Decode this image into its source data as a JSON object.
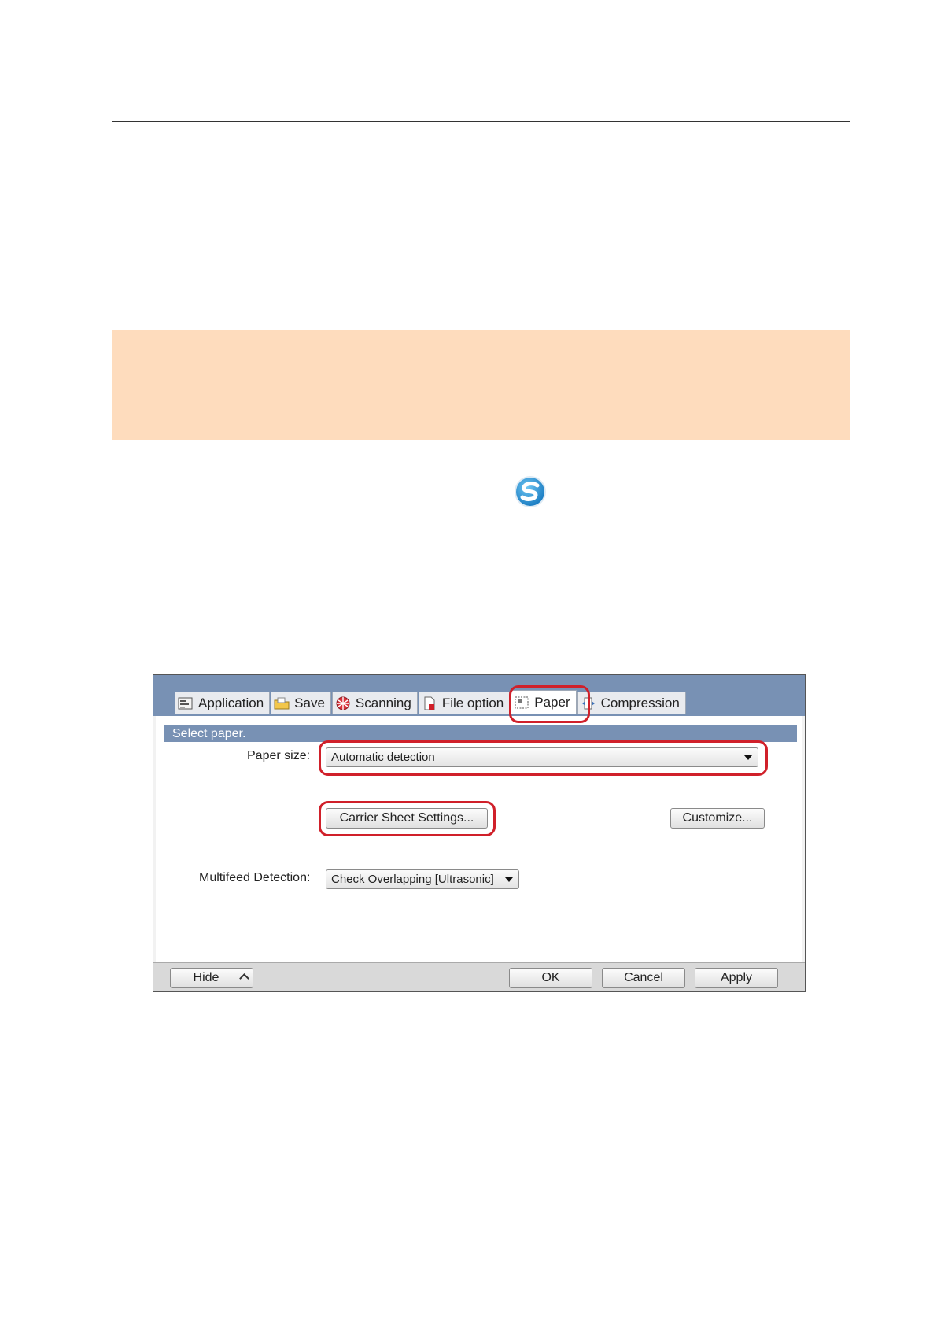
{
  "dialog": {
    "tabs": [
      {
        "label": "Application",
        "icon": "application-icon"
      },
      {
        "label": "Save",
        "icon": "folder-icon"
      },
      {
        "label": "Scanning",
        "icon": "scanning-icon"
      },
      {
        "label": "File option",
        "icon": "file-option-icon"
      },
      {
        "label": "Paper",
        "icon": "paper-icon",
        "active": true
      },
      {
        "label": "Compression",
        "icon": "compression-icon"
      }
    ],
    "section_title": "Select paper.",
    "paper_size_label": "Paper size:",
    "paper_size_value": "Automatic detection",
    "carrier_sheet_button": "Carrier Sheet Settings...",
    "customize_button": "Customize...",
    "multifeed_label": "Multifeed Detection:",
    "multifeed_value": "Check Overlapping [Ultrasonic]",
    "hide_button": "Hide",
    "ok_button": "OK",
    "cancel_button": "Cancel",
    "apply_button": "Apply"
  },
  "colors": {
    "note_box": "#fedcbd",
    "dialog_header": "#7891b4",
    "highlight": "#d0202a"
  }
}
